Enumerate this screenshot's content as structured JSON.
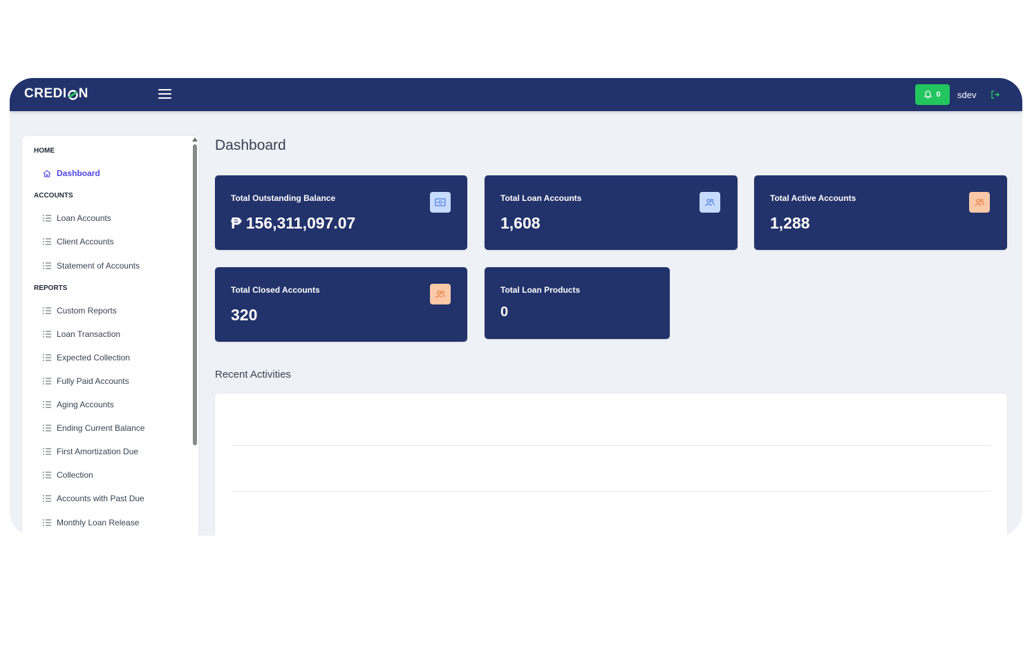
{
  "brand": {
    "name_left": "CREDI",
    "name_right": "N"
  },
  "topbar": {
    "notification_count": "0",
    "username": "sdev"
  },
  "colors": {
    "topbar": "#22326b",
    "card": "#22326b",
    "accent_green": "#22c55e",
    "active_link": "#4f46e5",
    "icon_blue_bg": "#c7dbff",
    "icon_orange_bg": "#fcc9a8"
  },
  "sidebar": {
    "sections": [
      {
        "title": "HOME",
        "items": [
          {
            "label": "Dashboard",
            "icon": "home-icon",
            "active": true
          }
        ]
      },
      {
        "title": "ACCOUNTS",
        "items": [
          {
            "label": "Loan Accounts",
            "icon": "list-icon"
          },
          {
            "label": "Client Accounts",
            "icon": "list-icon"
          },
          {
            "label": "Statement of Accounts",
            "icon": "list-icon"
          }
        ]
      },
      {
        "title": "REPORTS",
        "items": [
          {
            "label": "Custom Reports",
            "icon": "list-icon"
          },
          {
            "label": "Loan Transaction",
            "icon": "list-icon"
          },
          {
            "label": "Expected Collection",
            "icon": "list-icon"
          },
          {
            "label": "Fully Paid Accounts",
            "icon": "list-icon"
          },
          {
            "label": "Aging Accounts",
            "icon": "list-icon"
          },
          {
            "label": "Ending Current Balance",
            "icon": "list-icon"
          },
          {
            "label": "First Amortization Due",
            "icon": "list-icon"
          },
          {
            "label": "Collection",
            "icon": "list-icon"
          },
          {
            "label": "Accounts with Past Due",
            "icon": "list-icon"
          },
          {
            "label": "Monthly Loan Release",
            "icon": "list-icon"
          }
        ]
      }
    ]
  },
  "main": {
    "title": "Dashboard",
    "cards": [
      {
        "label": "Total Outstanding Balance",
        "value": "₱ 156,311,097.07",
        "icon": "money-icon"
      },
      {
        "label": "Total Loan Accounts",
        "value": "1,608",
        "icon": "users-icon"
      },
      {
        "label": "Total Active Accounts",
        "value": "1,288",
        "icon": "users-icon"
      },
      {
        "label": "Total Closed Accounts",
        "value": "320",
        "icon": "users-icon"
      },
      {
        "label": "Total Loan Products",
        "value": "0",
        "icon": ""
      }
    ],
    "recent_title": "Recent Activities"
  }
}
